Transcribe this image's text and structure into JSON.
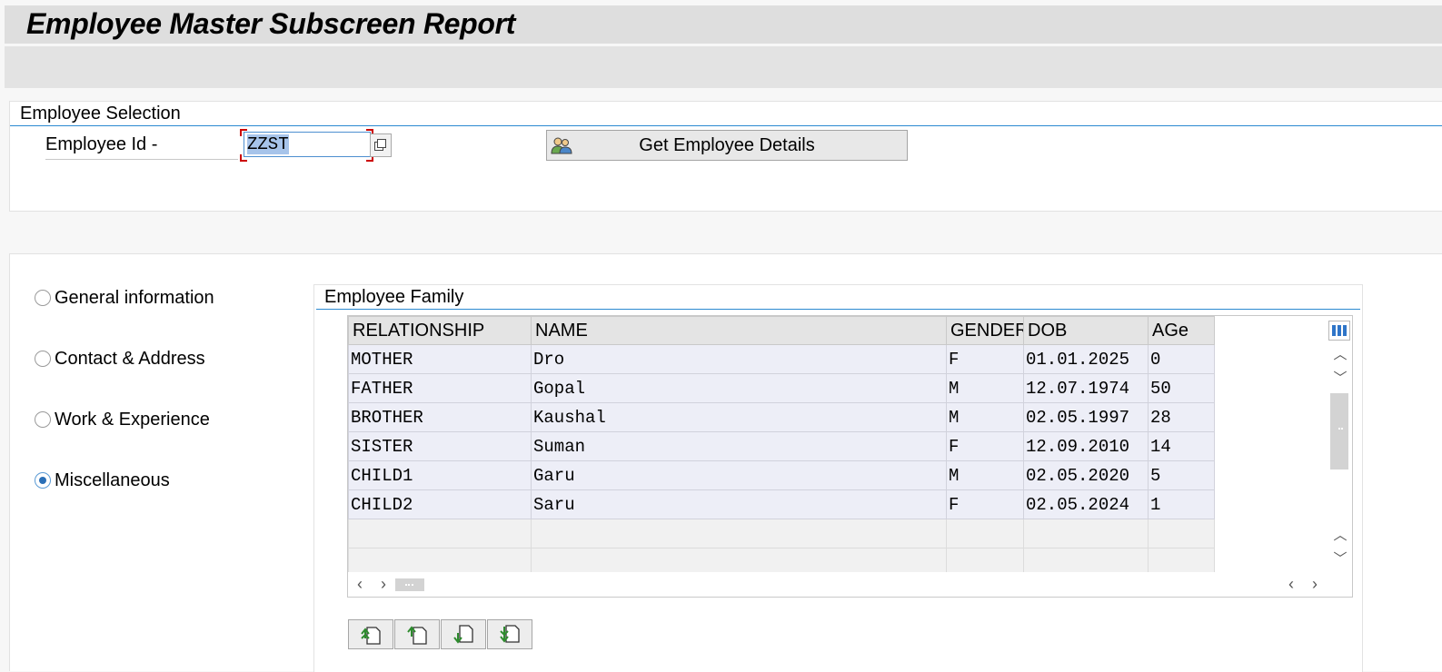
{
  "window": {
    "title": "Employee Master Subscreen Report"
  },
  "selection": {
    "group_title": "Employee Selection",
    "employee_id_label": "Employee Id -",
    "employee_id_value": "ZZST",
    "get_details_label": "Get Employee Details"
  },
  "options": [
    {
      "label": "General information",
      "checked": false
    },
    {
      "label": "Contact & Address",
      "checked": false
    },
    {
      "label": "Work & Experience",
      "checked": false
    },
    {
      "label": "Miscellaneous",
      "checked": true
    }
  ],
  "family": {
    "group_title": "Employee Family",
    "columns": [
      "RELATIONSHIP",
      "NAME",
      "GENDER",
      "DOB",
      "AGe"
    ],
    "rows": [
      [
        "MOTHER",
        "Dro",
        "F",
        "01.01.2025",
        "0"
      ],
      [
        "FATHER",
        "Gopal",
        "M",
        "12.07.1974",
        "50"
      ],
      [
        "BROTHER",
        "Kaushal",
        "M",
        "02.05.1997",
        "28"
      ],
      [
        "SISTER",
        "Suman",
        "F",
        "12.09.2010",
        "14"
      ],
      [
        "CHILD1",
        "Garu",
        "M",
        "02.05.2020",
        "5"
      ],
      [
        "CHILD2",
        "Saru",
        "F",
        "02.05.2024",
        "1"
      ]
    ],
    "empty_rows": 2
  },
  "icons": {
    "value_help": "value-help-icon",
    "employee": "employee-group-icon",
    "column_settings": "column-settings-icon",
    "scroll_up": "chevron-up-icon",
    "scroll_down": "chevron-down-icon",
    "scroll_left": "chevron-left-icon",
    "scroll_right": "chevron-right-icon",
    "first_page": "first-page-icon",
    "prev_page": "previous-page-icon",
    "next_page": "next-page-icon",
    "last_page": "last-page-icon"
  },
  "colors": {
    "accent_line": "#2c8ad1",
    "selected_text_bg": "#a7c4ea",
    "row_bg": "#edeef7",
    "header_bg": "#e4e4e4",
    "focus_bracket": "#cc0000",
    "radio_dot": "#2a6fb7"
  }
}
